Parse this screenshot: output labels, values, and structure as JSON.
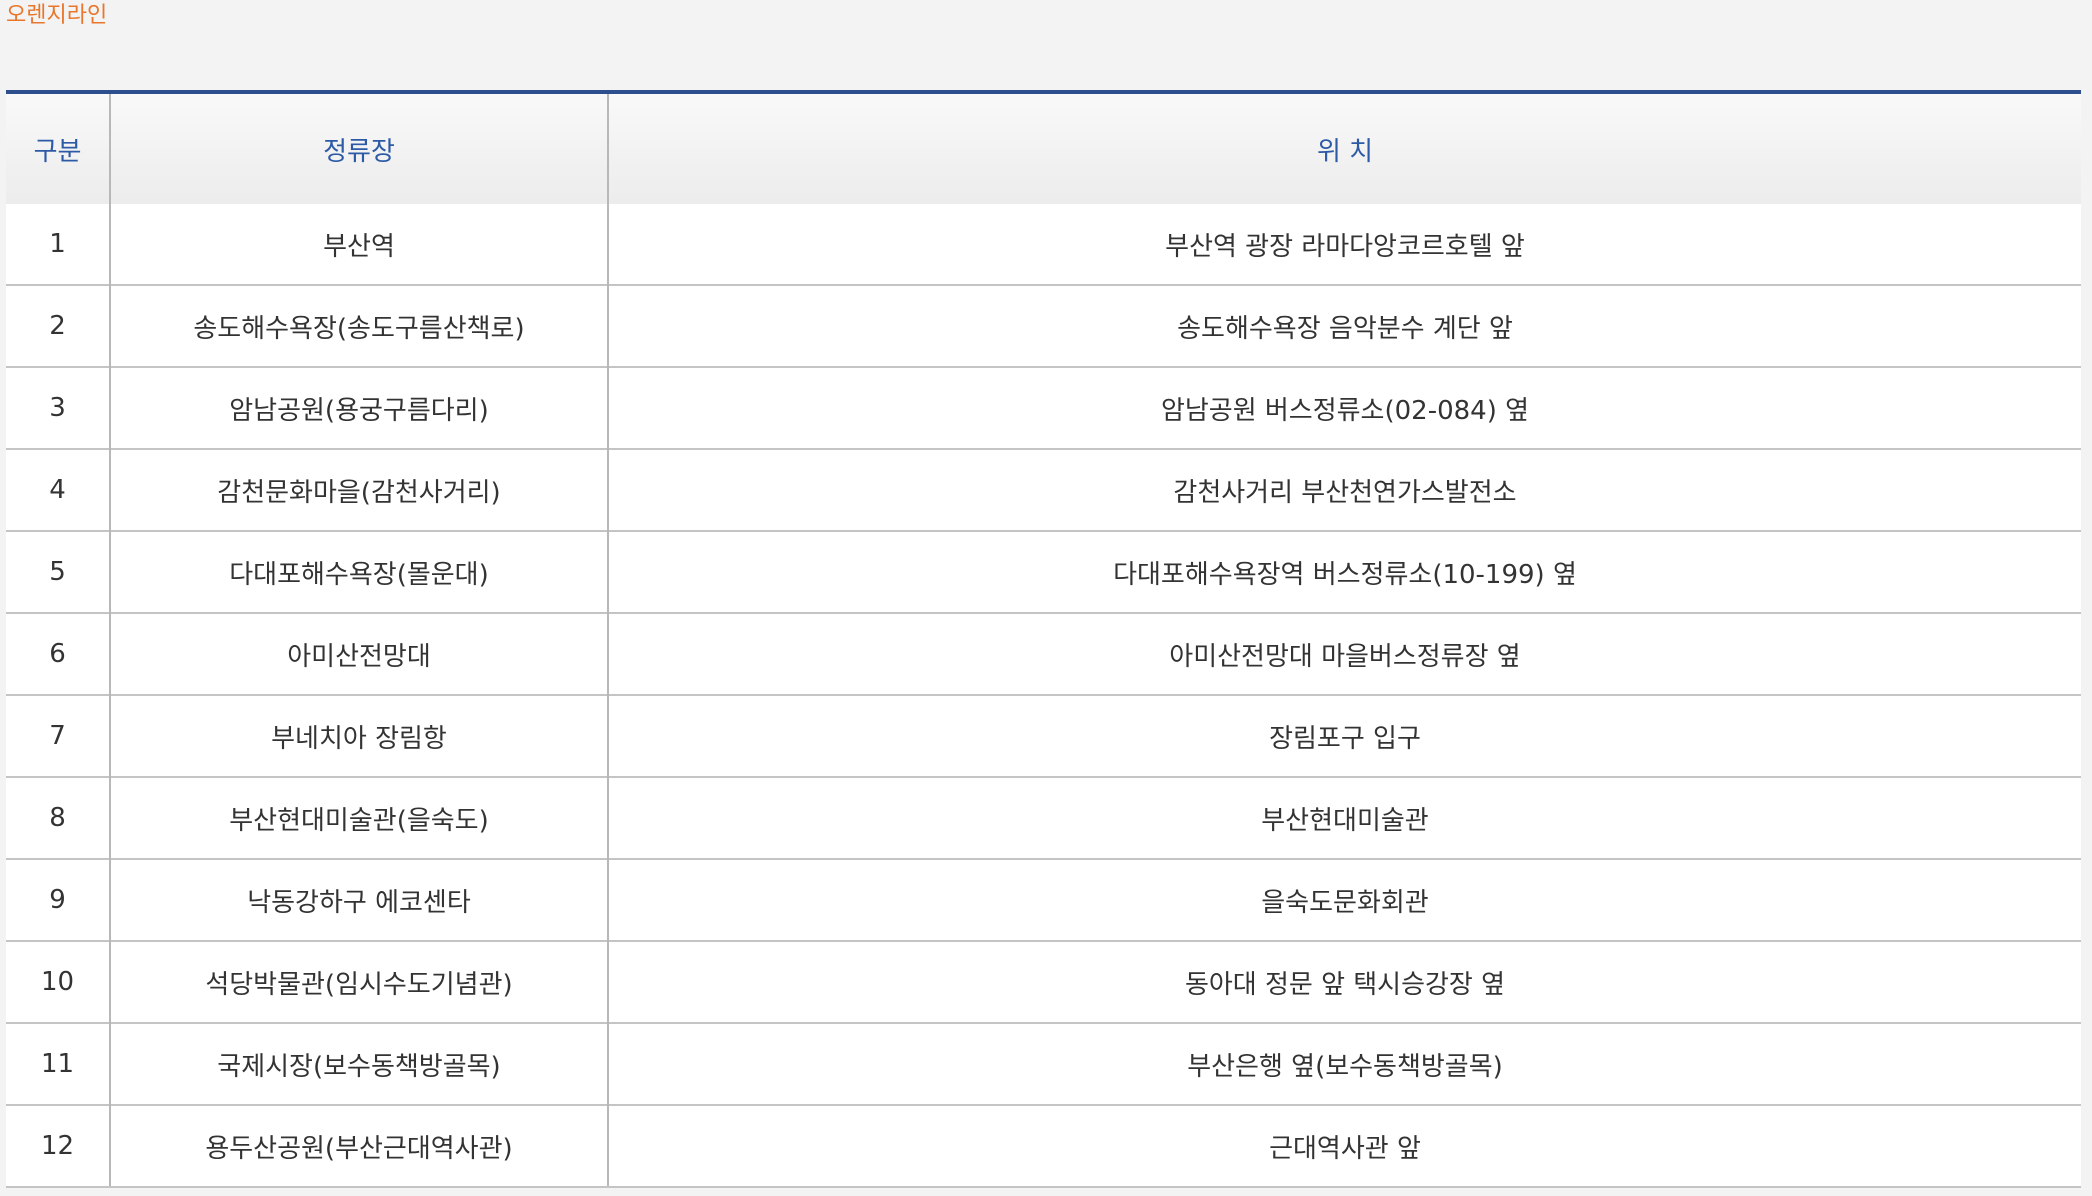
{
  "line_name": "오렌지라인",
  "colors": {
    "line_accent": "#e8762c",
    "header_text": "#2d5aa6",
    "top_rule": "#2d4f8e"
  },
  "table": {
    "headers": [
      "구분",
      "정류장",
      "위 치"
    ],
    "rows": [
      {
        "no": "1",
        "stop": "부산역",
        "location": "부산역 광장 라마다앙코르호텔 앞"
      },
      {
        "no": "2",
        "stop": "송도해수욕장(송도구름산책로)",
        "location": "송도해수욕장 음악분수 계단 앞"
      },
      {
        "no": "3",
        "stop": "암남공원(용궁구름다리)",
        "location": "암남공원 버스정류소(02-084) 옆"
      },
      {
        "no": "4",
        "stop": "감천문화마을(감천사거리)",
        "location": "감천사거리 부산천연가스발전소"
      },
      {
        "no": "5",
        "stop": "다대포해수욕장(몰운대)",
        "location": "다대포해수욕장역 버스정류소(10-199) 옆"
      },
      {
        "no": "6",
        "stop": "아미산전망대",
        "location": "아미산전망대 마을버스정류장 옆"
      },
      {
        "no": "7",
        "stop": "부네치아 장림항",
        "location": "장림포구 입구"
      },
      {
        "no": "8",
        "stop": "부산현대미술관(을숙도)",
        "location": "부산현대미술관"
      },
      {
        "no": "9",
        "stop": "낙동강하구 에코센타",
        "location": "을숙도문화회관"
      },
      {
        "no": "10",
        "stop": "석당박물관(임시수도기념관)",
        "location": "동아대 정문 앞 택시승강장 옆"
      },
      {
        "no": "11",
        "stop": "국제시장(보수동책방골목)",
        "location": "부산은행 옆(보수동책방골목)"
      },
      {
        "no": "12",
        "stop": "용두산공원(부산근대역사관)",
        "location": "근대역사관 앞"
      }
    ]
  }
}
